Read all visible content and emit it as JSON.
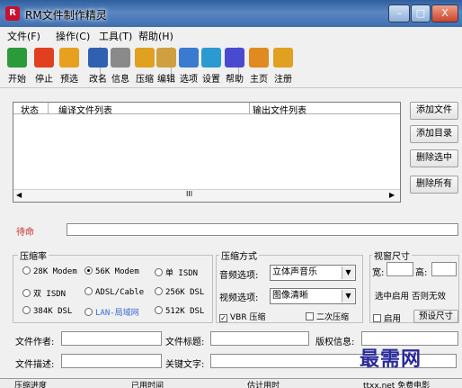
{
  "window": {
    "title": "RM文件制作精灵",
    "min": "–",
    "max": "□",
    "close": "X"
  },
  "menu": [
    "文件(F)",
    "操作(C)",
    "工具(T)",
    "帮助(H)"
  ],
  "toolbar": [
    {
      "label": "开始",
      "icon": "start-arrow-icon",
      "color": "#2a9a3a"
    },
    {
      "label": "停止",
      "icon": "stop-icon",
      "color": "#e04020"
    },
    {
      "label": "预选",
      "icon": "music-note-icon",
      "color": "#e8a020"
    },
    {
      "label": "改名",
      "icon": "rename-one-icon",
      "color": "#3060b0"
    },
    {
      "label": "信息",
      "icon": "speaker-info-icon",
      "color": "#8a8a8a"
    },
    {
      "label": "压缩",
      "icon": "compress-funnel-icon",
      "color": "#e0a020"
    },
    {
      "label": "编辑",
      "icon": "film-strip-icon",
      "color": "#d0a040"
    },
    {
      "label": "选项",
      "icon": "options-page-icon",
      "color": "#3a7ad0"
    },
    {
      "label": "设置",
      "icon": "settings-diamond-icon",
      "color": "#2a9ad0"
    },
    {
      "label": "帮助",
      "icon": "help-question-icon",
      "color": "#4a4ad0"
    },
    {
      "label": "主页",
      "icon": "home-icon",
      "color": "#e08a20"
    },
    {
      "label": "注册",
      "icon": "register-key-icon",
      "color": "#e0a020"
    }
  ],
  "list": {
    "cols": [
      "状态",
      "编译文件列表",
      "输出文件列表"
    ],
    "scroll_mark": "III"
  },
  "side_buttons": [
    "添加文件",
    "添加目录",
    "删除选中",
    "删除所有"
  ],
  "command_label": "待命",
  "compress_rate": {
    "title": "压缩率",
    "options": [
      "28K Modem",
      "56K Modem",
      "单 ISDN",
      "双 ISDN",
      "ADSL/Cable",
      "256K DSL",
      "384K DSL",
      "LAN-局域网",
      "512K DSL"
    ],
    "selected": "56K Modem"
  },
  "compress_mode": {
    "title": "压缩方式",
    "audio_label": "音频选项:",
    "audio_value": "立体声音乐",
    "video_label": "视频选项:",
    "video_value": "图像清晰",
    "vbr_label": "VBR 压缩",
    "vbr_checked": true,
    "twopass_label": "二次压缩",
    "twopass_checked": false
  },
  "window_size": {
    "title": "视窗尺寸",
    "width_label": "宽:",
    "height_label": "高:",
    "hint": "选中启用 否则无效",
    "enable_label": "启用",
    "preset_button": "预设尺寸"
  },
  "meta": {
    "author_label": "文件作者:",
    "title_label": "文件标题:",
    "copyright_label": "版权信息:",
    "desc_label": "文件描述:",
    "keyword_label": "关键文字:"
  },
  "status": {
    "progress": "压缩进度",
    "used": "已用时间",
    "est": "估计用时",
    "site": "ttxx.net 免费电影"
  },
  "watermark": "最需网",
  "colors": {
    "command": "#c83232",
    "title_bar": "#3f6fb0"
  }
}
